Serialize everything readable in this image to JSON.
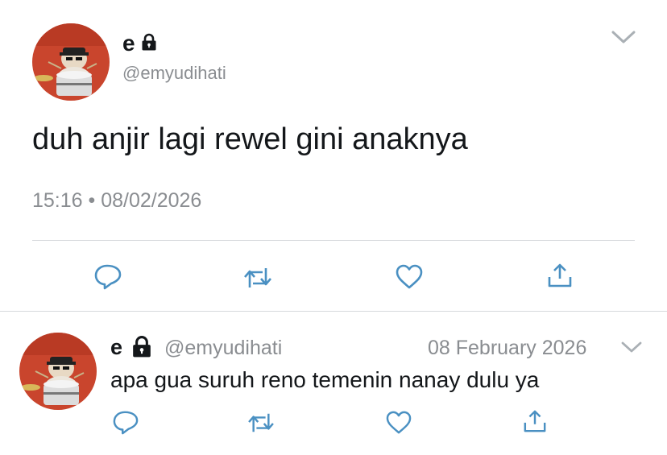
{
  "main_tweet": {
    "display_name": "e",
    "handle": "@emyudihati",
    "text": "duh anjir lagi rewel gini anaknya",
    "timestamp": "15:16 • 08/02/2026",
    "protected_icon": "lock-icon",
    "menu_icon": "chevron-down-icon",
    "actions": [
      "reply-icon",
      "retweet-icon",
      "like-icon",
      "share-icon"
    ]
  },
  "reply_tweet": {
    "display_name": "e",
    "handle": "@emyudihati",
    "date": "08 February 2026",
    "text": "apa gua suruh reno temenin nanay dulu ya",
    "protected_icon": "lock-icon",
    "menu_icon": "chevron-down-icon",
    "actions": [
      "reply-icon",
      "retweet-icon",
      "like-icon",
      "share-icon"
    ]
  },
  "colors": {
    "text": "#14171a",
    "muted": "#8a8d91",
    "icon": "#4a90c2",
    "divider": "#d6d9dc",
    "avatar_bg": "#c9452d"
  }
}
